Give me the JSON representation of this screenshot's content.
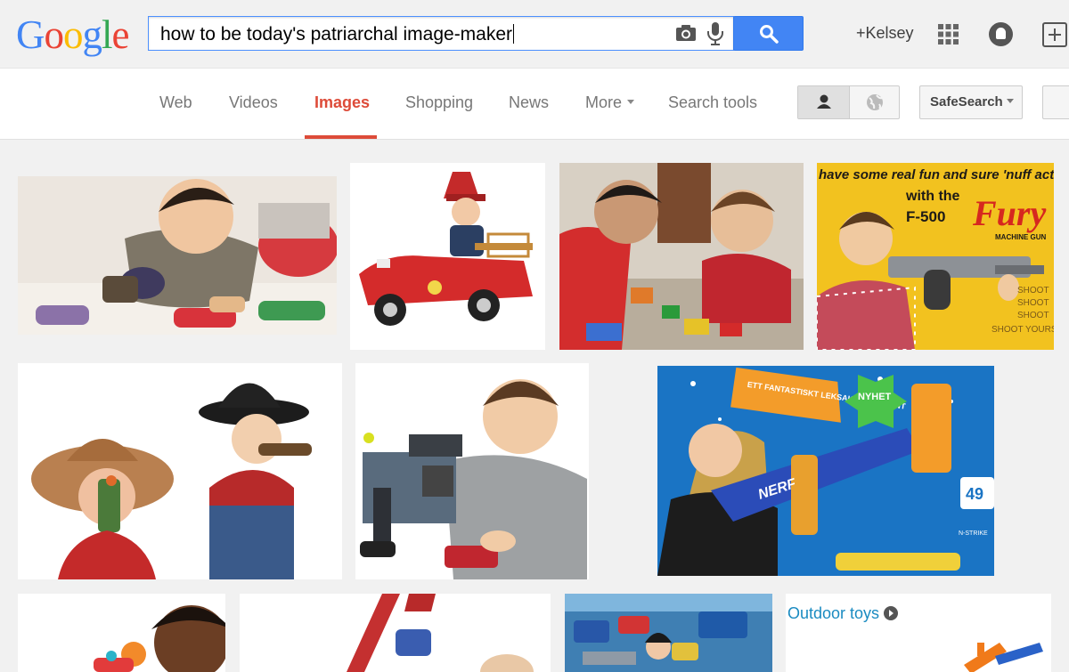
{
  "logo": {
    "text": "Google"
  },
  "search": {
    "query": "how to be today's patriarchal image-maker"
  },
  "header": {
    "user": "+Kelsey"
  },
  "nav": {
    "tabs": [
      "Web",
      "Videos",
      "Images",
      "Shopping",
      "News",
      "More",
      "Search tools"
    ],
    "active_tab": "Images",
    "safesearch_label": "SafeSearch"
  },
  "results": {
    "tiles": [
      "boy playing with toy cars",
      "boy in red pedal fire truck",
      "two boys playing with lego blocks",
      "vintage Fury F-500 toy gun ad",
      "two boys in cowboy hats with toy guns",
      "boy with batman lego set",
      "girl with blue Nerf blaster",
      "child with toy",
      "red toy digger",
      "child with train set",
      "Outdoor toys"
    ],
    "fury_ad": {
      "line1": "have some real fun and sure 'nuff action",
      "line2": "with the",
      "model": "F-500",
      "brand": "Fury",
      "sub": "MACHINE GUN",
      "shoot": [
        "SHOOT",
        "SHOOT",
        "SHOOT",
        "SHOOT YOURS"
      ]
    },
    "nerf_ad": {
      "badge1": "ETT FANTASTISKT LEKSAKSSORTIMENT",
      "badge2": "NYHET",
      "brand": "NERF",
      "price": "49",
      "fine": "N-STRIKE"
    },
    "outdoor_toys_label": "Outdoor toys"
  },
  "colors": {
    "accent_red": "#dd4b39",
    "search_blue": "#4285f4",
    "link_blue": "#1a8bc1"
  }
}
